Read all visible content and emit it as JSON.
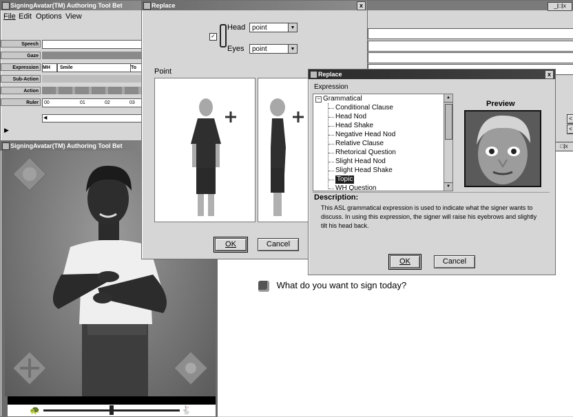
{
  "main_window": {
    "title": "SigningAvatar(TM) Authoring Tool Bet",
    "menu": [
      "File",
      "Edit",
      "Options",
      "View"
    ],
    "rows": [
      "Speech",
      "Gaze",
      "Expression",
      "Sub-Action",
      "Action",
      "Ruler"
    ],
    "expression_cells": [
      "MH",
      "Smile",
      "To"
    ],
    "ruler_ticks": [
      "00",
      "01",
      "02",
      "03"
    ],
    "win_controls": "_|□|x",
    "right_buttons": [
      "<",
      "<"
    ]
  },
  "avatar_window": {
    "title": "SigningAvatar(TM) Authoring Tool Bet"
  },
  "replace_head": {
    "title": "Replace",
    "head_label": "Head",
    "head_value": "point",
    "eyes_label": "Eyes",
    "eyes_value": "point",
    "point_label": "Point",
    "ok": "OK",
    "cancel": "Cancel"
  },
  "replace_expr": {
    "title": "Replace",
    "expression_label": "Expression",
    "root": "Grammatical",
    "items": [
      "Conditional Clause",
      "Head Nod",
      "Head Shake",
      "Negative Head Nod",
      "Relative Clause",
      "Rhetorical Question",
      "Slight Head Nod",
      "Slight Head Shake",
      "Topic",
      "WH Question"
    ],
    "selected_index": 8,
    "preview_label": "Preview",
    "description_label": "Description:",
    "description": "This ASL grammatical expression is used to indicate what the signer wants to discuss. In using this expression, the signer will raise his eyebrows and slightly tilt his head back.",
    "ok": "OK",
    "cancel": "Cancel"
  },
  "prompt": {
    "text": "What do you want to sign today?"
  },
  "colors": {
    "titlebar": "#6a6a6a",
    "selection": "#1c1c1c",
    "avatar_bg": "#7b7b7b"
  }
}
